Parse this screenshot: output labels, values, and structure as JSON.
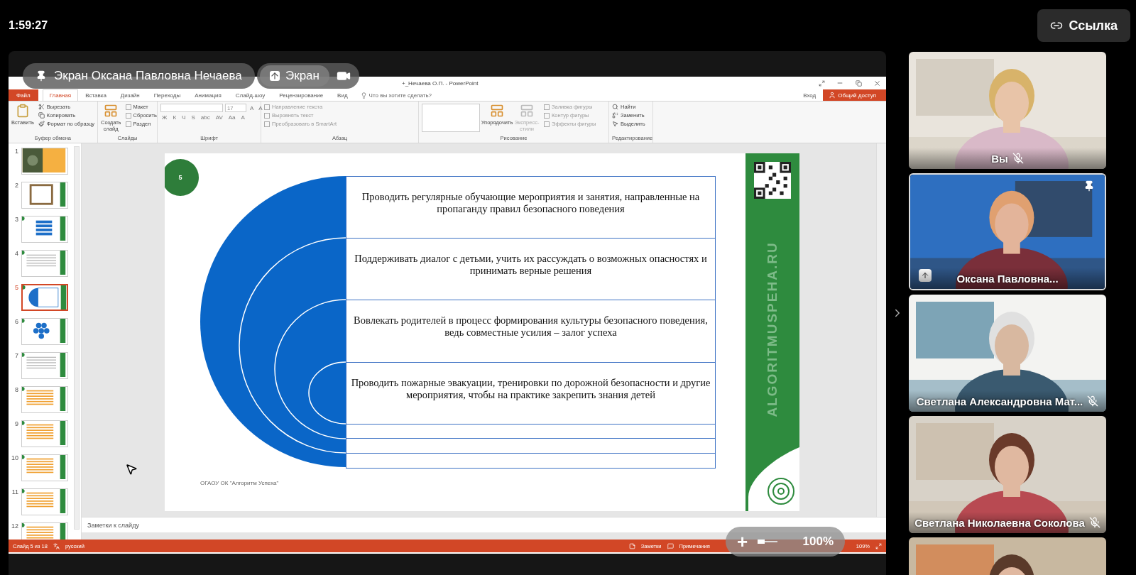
{
  "call": {
    "time": "1:59:27",
    "link_button": "Ссылка"
  },
  "share_overlay": {
    "presenter": "Экран Оксана Павловна Нечаева",
    "screen_button": "Экран"
  },
  "powerpoint": {
    "title": "+_Нечаева О.П. - PowerPoint",
    "tabs": [
      {
        "label": "Файл",
        "kind": "file",
        "selected": false
      },
      {
        "label": "Главная",
        "kind": "tab",
        "selected": true
      },
      {
        "label": "Вставка",
        "kind": "tab",
        "selected": false
      },
      {
        "label": "Дизайн",
        "kind": "tab",
        "selected": false
      },
      {
        "label": "Переходы",
        "kind": "tab",
        "selected": false
      },
      {
        "label": "Анимация",
        "kind": "tab",
        "selected": false
      },
      {
        "label": "Слайд-шоу",
        "kind": "tab",
        "selected": false
      },
      {
        "label": "Рецензирование",
        "kind": "tab",
        "selected": false
      },
      {
        "label": "Вид",
        "kind": "tab",
        "selected": false
      }
    ],
    "tell_me": "Что вы хотите сделать?",
    "sign_in": "Вход",
    "share_button": "Общий доступ",
    "ribbon": [
      {
        "label": "Буфер обмена",
        "kind": "clipboard",
        "large": [
          {
            "label": "Вставить",
            "disabled": false
          }
        ],
        "small": [
          {
            "label": "Вырезать",
            "disabled": false
          },
          {
            "label": "Копировать",
            "disabled": false
          },
          {
            "label": "Формат по образцу",
            "disabled": false
          }
        ]
      },
      {
        "label": "Слайды",
        "kind": "slides",
        "large": [
          {
            "label": "Создать слайд",
            "disabled": false
          }
        ],
        "small": [
          {
            "label": "Макет",
            "disabled": false
          },
          {
            "label": "Сбросить",
            "disabled": false
          },
          {
            "label": "Раздел",
            "disabled": false
          }
        ]
      },
      {
        "label": "Шрифт",
        "kind": "font",
        "font_size": "17",
        "buttons": [
          "A",
          "A",
          "Ж",
          "К",
          "Ч",
          "S",
          "abc",
          "AV",
          "Aa",
          "A"
        ]
      },
      {
        "label": "Абзац",
        "kind": "paragraph",
        "small": [
          {
            "label": "Направление текста",
            "disabled": true
          },
          {
            "label": "Выровнять текст",
            "disabled": true
          },
          {
            "label": "Преобразовать в SmartArt",
            "disabled": true
          }
        ]
      },
      {
        "label": "Рисование",
        "kind": "drawing",
        "large": [
          {
            "label": "Упорядочить",
            "disabled": false
          },
          {
            "label": "Экспресс-стили",
            "disabled": true
          }
        ],
        "small": [
          {
            "label": "Заливка фигуры",
            "disabled": true
          },
          {
            "label": "Контур фигуры",
            "disabled": true
          },
          {
            "label": "Эффекты фигуры",
            "disabled": true
          }
        ]
      },
      {
        "label": "Редактирование",
        "kind": "editing",
        "small": [
          {
            "label": "Найти",
            "disabled": false
          },
          {
            "label": "Заменить",
            "disabled": false
          },
          {
            "label": "Выделить",
            "disabled": false
          }
        ]
      }
    ],
    "thumbnails": [
      {
        "number": "1",
        "selected": false
      },
      {
        "number": "2",
        "kind": "frame",
        "selected": false
      },
      {
        "number": "3",
        "kind": "list",
        "selected": false
      },
      {
        "number": "4",
        "kind": "text",
        "selected": false
      },
      {
        "number": "5",
        "kind": "arcs",
        "selected": true
      },
      {
        "number": "6",
        "kind": "hex",
        "selected": false
      },
      {
        "number": "7",
        "kind": "text",
        "selected": false
      },
      {
        "number": "8",
        "kind": "lines",
        "selected": false
      },
      {
        "number": "9",
        "kind": "lines",
        "selected": false
      },
      {
        "number": "10",
        "kind": "lines",
        "selected": false
      },
      {
        "number": "11",
        "kind": "lines",
        "selected": false
      },
      {
        "number": "12",
        "kind": "lines",
        "selected": false
      }
    ],
    "slide": {
      "number": "5",
      "rows": [
        "Проводить регулярные обучающие мероприятия и занятия, направленные на пропаганду правил безопасного поведения",
        "Поддерживать диалог с детьми, учить их рассуждать о возможных опасностях и принимать верные решения",
        "Вовлекать родителей в процесс формирования культуры безопасного поведения, ведь совместные усилия – залог успеха",
        "Проводить пожарные эвакуации, тренировки по дорожной безопасности и другие мероприятия, чтобы на практике закрепить знания детей"
      ],
      "brand": "ALGORITMUSPEHA.RU",
      "footer": "ОГАОУ ОК \"Алгоритм Успеха\""
    },
    "notes_placeholder": "Заметки к слайду",
    "status_bar": {
      "slide": "Слайд 5 из 18",
      "language": "русский",
      "notes": "Заметки",
      "comments": "Примечания",
      "zoom": "109%"
    }
  },
  "zoom_overlay": {
    "zoom_in": "+",
    "value": "100%"
  },
  "participants": [
    {
      "name": "Вы",
      "muted": true,
      "pinned": false,
      "sharing": false
    },
    {
      "name": "Оксана Павловна...",
      "muted": false,
      "pinned": true,
      "sharing": true
    },
    {
      "name": "Светлана Александровна Мат...",
      "muted": true,
      "pinned": false,
      "sharing": false
    },
    {
      "name": "Светлана Николаевна Соколова",
      "muted": true,
      "pinned": false,
      "sharing": false
    }
  ]
}
